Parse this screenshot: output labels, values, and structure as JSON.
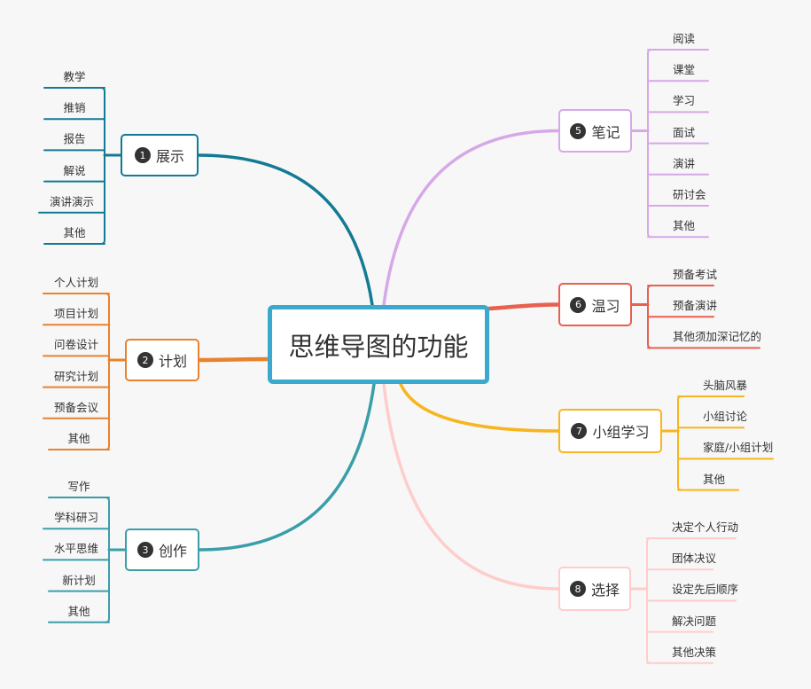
{
  "central": {
    "title": "思维导图的功能",
    "color": "#3aa9cd"
  },
  "topics": [
    {
      "id": 1,
      "num": "1",
      "label": "展示",
      "side": "left",
      "color": "#137a94",
      "children": [
        "教学",
        "推销",
        "报告",
        "解说",
        "演讲演示",
        "其他"
      ]
    },
    {
      "id": 2,
      "num": "2",
      "label": "计划",
      "side": "left",
      "color": "#e8822e",
      "children": [
        "个人计划",
        "项目计划",
        "问卷设计",
        "研究计划",
        "预备会议",
        "其他"
      ]
    },
    {
      "id": 3,
      "num": "3",
      "label": "创作",
      "side": "left",
      "color": "#3a9ea9",
      "children": [
        "写作",
        "学科研习",
        "水平思维",
        "新计划",
        "其他"
      ]
    },
    {
      "id": 5,
      "num": "5",
      "label": "笔记",
      "side": "right",
      "color": "#d6a8e8",
      "children": [
        "阅读",
        "课堂",
        "学习",
        "面试",
        "演讲",
        "研讨会",
        "其他"
      ]
    },
    {
      "id": 6,
      "num": "6",
      "label": "温习",
      "side": "right",
      "color": "#e8604f",
      "children": [
        "预备考试",
        "预备演讲",
        "其他须加深记忆的"
      ]
    },
    {
      "id": 7,
      "num": "7",
      "label": "小组学习",
      "side": "right",
      "color": "#f7b51f",
      "children": [
        "头脑风暴",
        "小组讨论",
        "家庭/小组计划",
        "其他"
      ]
    },
    {
      "id": 8,
      "num": "8",
      "label": "选择",
      "side": "right",
      "color": "#ffcccc",
      "children": [
        "决定个人行动",
        "团体决议",
        "设定先后顺序",
        "解决问题",
        "其他决策"
      ]
    }
  ]
}
